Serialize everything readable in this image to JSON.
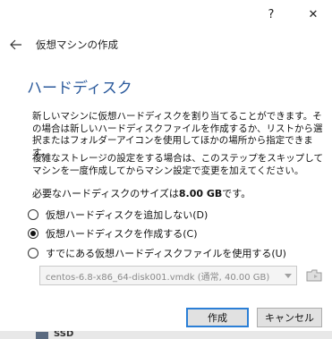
{
  "titlebar": {
    "help_label": "?",
    "close_label": "✕"
  },
  "nav": {
    "title": "仮想マシンの作成"
  },
  "page": {
    "title": "ハードディスク",
    "description": "新しいマシンに仮想ハードディスクを割り当てることができます。その場合は新しいハードディスクファイルを作成するか、リストから選択またはフォルダーアイコンを使用してほかの場所から指定できます。",
    "description2": "複雑なストレージの設定をする場合は、このステップをスキップしてマシンを一度作成してからマシン設定で変更を加えてください。",
    "size_prefix": "必要なハードディスクのサイズは",
    "size_value": "8.00 GB",
    "size_suffix": "です。"
  },
  "options": [
    {
      "label": "仮想ハードディスクを追加しない(D)",
      "checked": false
    },
    {
      "label": "仮想ハードディスクを作成する(C)",
      "checked": true
    },
    {
      "label": "すでにある仮想ハードディスクファイルを使用する(U)",
      "checked": false
    }
  ],
  "file_select": {
    "value": "centos-6.8-x86_64-disk001.vmdk (通常, 40.00 GB)"
  },
  "buttons": {
    "create": "作成",
    "cancel": "キャンセル"
  },
  "background": {
    "partial_text": "SSD"
  }
}
